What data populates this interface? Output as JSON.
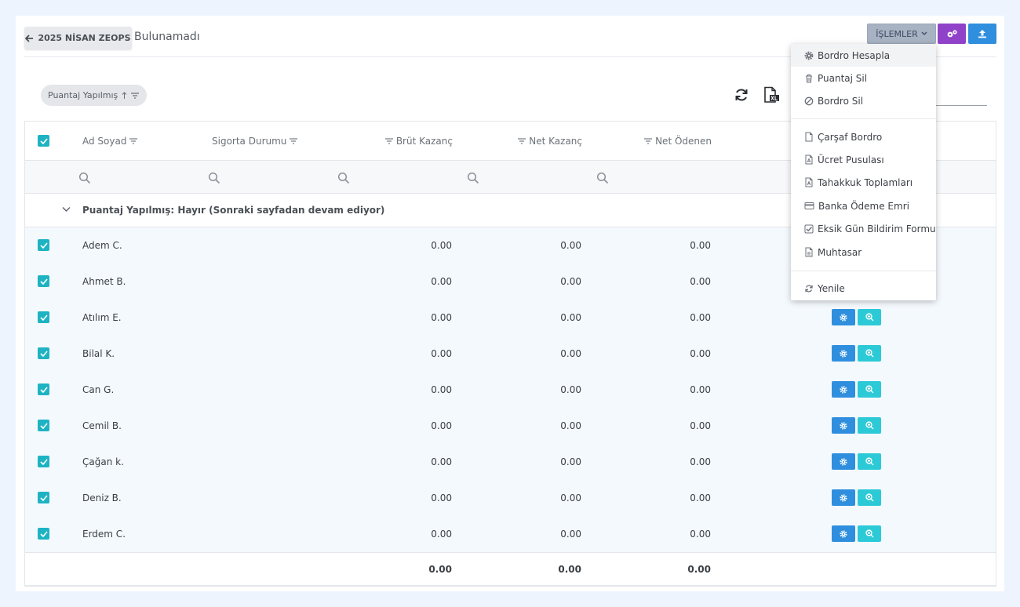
{
  "header": {
    "back_label": "2025 NİSAN ZEOPS",
    "title": "Bulunamadı",
    "actions_label": "İŞLEMLER"
  },
  "toolbar": {
    "group_chip_label": "Puantaj Yapılmış"
  },
  "columns": {
    "name": "Ad Soyad",
    "insurance": "Sigorta Durumu",
    "gross": "Brüt Kazanç",
    "net": "Net Kazanç",
    "paid": "Net Ödenen"
  },
  "group_row": {
    "label": "Puantaj Yapılmış: Hayır (Sonraki sayfadan devam ediyor)"
  },
  "rows": [
    {
      "name": "Adem C.",
      "gross": "0.00",
      "net": "0.00",
      "paid": "0.00"
    },
    {
      "name": "Ahmet B.",
      "gross": "0.00",
      "net": "0.00",
      "paid": "0.00"
    },
    {
      "name": "Atılım E.",
      "gross": "0.00",
      "net": "0.00",
      "paid": "0.00"
    },
    {
      "name": "Bilal K.",
      "gross": "0.00",
      "net": "0.00",
      "paid": "0.00"
    },
    {
      "name": "Can G.",
      "gross": "0.00",
      "net": "0.00",
      "paid": "0.00"
    },
    {
      "name": "Cemil B.",
      "gross": "0.00",
      "net": "0.00",
      "paid": "0.00"
    },
    {
      "name": "Çağan k.",
      "gross": "0.00",
      "net": "0.00",
      "paid": "0.00"
    },
    {
      "name": "Deniz B.",
      "gross": "0.00",
      "net": "0.00",
      "paid": "0.00"
    },
    {
      "name": "Erdem C.",
      "gross": "0.00",
      "net": "0.00",
      "paid": "0.00"
    }
  ],
  "totals": {
    "gross": "0.00",
    "net": "0.00",
    "paid": "0.00"
  },
  "menu": {
    "items": [
      {
        "label": "Bordro Hesapla",
        "icon": "gear-icon"
      },
      {
        "label": "Puantaj Sil",
        "icon": "trash-icon"
      },
      {
        "label": "Bordro Sil",
        "icon": "ban-icon"
      },
      {
        "label": "Çarşaf Bordro",
        "icon": "file-icon"
      },
      {
        "label": "Ücret Pusulası",
        "icon": "pdf-file-icon"
      },
      {
        "label": "Tahakkuk Toplamları",
        "icon": "pdf-file-icon"
      },
      {
        "label": "Banka Ödeme Emri",
        "icon": "credit-card-icon"
      },
      {
        "label": "Eksik Gün Bildirim Formu",
        "icon": "check-square-icon"
      },
      {
        "label": "Muhtasar",
        "icon": "file-text-icon"
      },
      {
        "label": "Yenile",
        "icon": "refresh-icon"
      }
    ]
  },
  "colors": {
    "checkbox": "#1eb3c3",
    "primary_blue": "#2f8fde",
    "cyan": "#2ccad6",
    "purple": "#9043c8",
    "actions_button": "#a7b2c2",
    "row_background": "#f4f9fd"
  }
}
